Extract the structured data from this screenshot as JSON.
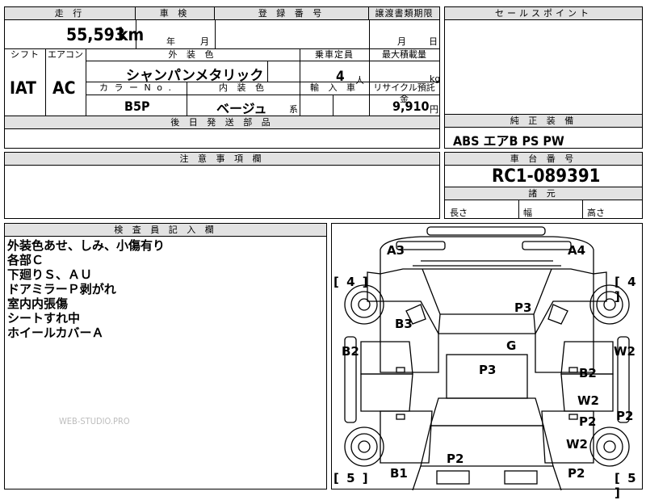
{
  "top": {
    "mileage_label": "走 行",
    "mileage_value": "55,593",
    "mileage_unit": "km",
    "inspection_label": "車 検",
    "inspection_year": "年",
    "inspection_month": "月",
    "registration_label": "登 録 番 号",
    "transfer_label": "譲渡書類期限",
    "transfer_month": "月",
    "transfer_day": "日",
    "shift_label": "シフト",
    "shift_value": "IAT",
    "ac_label": "エアコン",
    "ac_value": "AC",
    "exterior_label": "外 装 色",
    "exterior_value": "シャンパンメタリック",
    "capacity_label": "乗車定員",
    "capacity_value": "4",
    "capacity_unit": "人",
    "load_label": "最大積載量",
    "load_unit": "kg",
    "color_no_label": "カ ラ ー N o .",
    "color_no_value": "B5P",
    "interior_label": "内 装 色",
    "interior_value": "ベージュ",
    "interior_suffix": "系",
    "import_label": "輸 入 車",
    "recycle_label": "リサイクル預託金",
    "recycle_value": "9,910",
    "recycle_unit": "円",
    "later_parts_label": "後 日 発 送 部 品"
  },
  "sales_point": {
    "label": "セールスポイント"
  },
  "equipment": {
    "label": "純 正 装 備",
    "value": "ABS エアB PS PW"
  },
  "notes": {
    "label": "注 意 事 項 欄"
  },
  "chassis": {
    "label": "車 台 番 号",
    "value": "RC1-089391",
    "spec_label": "諸 元",
    "length_label": "長さ",
    "width_label": "幅",
    "height_label": "高さ"
  },
  "inspector": {
    "label": "検 査 員 記 入 欄",
    "remarks": [
      "外装色あせ、しみ、小傷有り",
      "各部Ｃ",
      "下廻りＳ、ＡＵ",
      "ドアミラーＰ剥がれ",
      "室内内張傷",
      "シートすれ中",
      "ホイールカバーＡ"
    ],
    "watermark": "WEB-STUDIO.PRO"
  },
  "diagram": {
    "marks": {
      "a3": "A3",
      "a4": "A4",
      "p3_top": "P3",
      "b3": "B3",
      "g": "G",
      "b2_left": "B2",
      "p3_mid": "P3",
      "w2_right": "W2",
      "b2_right": "B2",
      "w2_mid": "W2",
      "p2_right": "P2",
      "p2_right2": "P2",
      "w2_lower": "W2",
      "p2_center": "P2",
      "b1": "B1",
      "p2_bottom": "P2"
    },
    "bracket_tl": "[ 4 ]",
    "bracket_tr": "[ 4 ]",
    "bracket_bl": "[ 5 ]",
    "bracket_br": "[ 5 ]"
  }
}
